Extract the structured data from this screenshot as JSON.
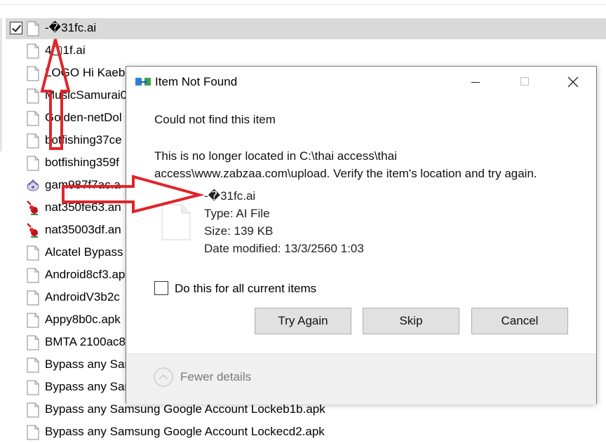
{
  "files": [
    {
      "name": "-�31fc.ai",
      "icon": "blank-file-icon",
      "selected": true
    },
    {
      "name": "4▢1f.ai",
      "icon": "blank-file-icon"
    },
    {
      "name": "LOGO Hi Kaeb",
      "icon": "blank-file-icon"
    },
    {
      "name": "MusicSamurai0",
      "icon": "blank-file-icon"
    },
    {
      "name": "Golden-netDol",
      "icon": "blank-file-icon"
    },
    {
      "name": "botfishing37ce",
      "icon": "blank-file-icon"
    },
    {
      "name": "botfishing359f",
      "icon": "blank-file-icon"
    },
    {
      "name": "gam987f7ac.a",
      "icon": "app-icon"
    },
    {
      "name": "nat350fe63.an",
      "icon": "cursor-file-icon"
    },
    {
      "name": "nat35003df.an",
      "icon": "cursor-file-icon"
    },
    {
      "name": "Alcatel Bypass",
      "icon": "blank-file-icon"
    },
    {
      "name": "Android8cf3.ap",
      "icon": "blank-file-icon"
    },
    {
      "name": "AndroidV3b2c",
      "icon": "blank-file-icon"
    },
    {
      "name": "Appy8b0c.apk",
      "icon": "blank-file-icon"
    },
    {
      "name": "BMTA 2100ac8",
      "icon": "blank-file-icon"
    },
    {
      "name": "Bypass any Sar",
      "icon": "blank-file-icon"
    },
    {
      "name": "Bypass any Sar",
      "icon": "blank-file-icon"
    },
    {
      "name": "Bypass any Samsung Google Account Lockeb1b.apk",
      "icon": "blank-file-icon"
    },
    {
      "name": "Bypass any Samsung Google Account Lockecd2.apk",
      "icon": "blank-file-icon"
    }
  ],
  "dialog": {
    "title": "Item Not Found",
    "heading": "Could not find this item",
    "message": "This is no longer located in C:\\thai access\\thai access\\www.zabzaa.com\\upload. Verify the item's location and try again.",
    "file_name": "-�31fc.ai",
    "type": "Type: AI File",
    "size": "Size: 139 KB",
    "date_modified": "Date modified: 13/3/2560 1:03",
    "checkbox_label": "Do this for all current items",
    "buttons": {
      "try_again": "Try Again",
      "skip": "Skip",
      "cancel": "Cancel"
    },
    "fewer_details": "Fewer details"
  },
  "colors": {
    "annotation_arrow": "#e0242a",
    "selected_row": "#d9d9d9",
    "button_bg": "#e1e1e1"
  }
}
